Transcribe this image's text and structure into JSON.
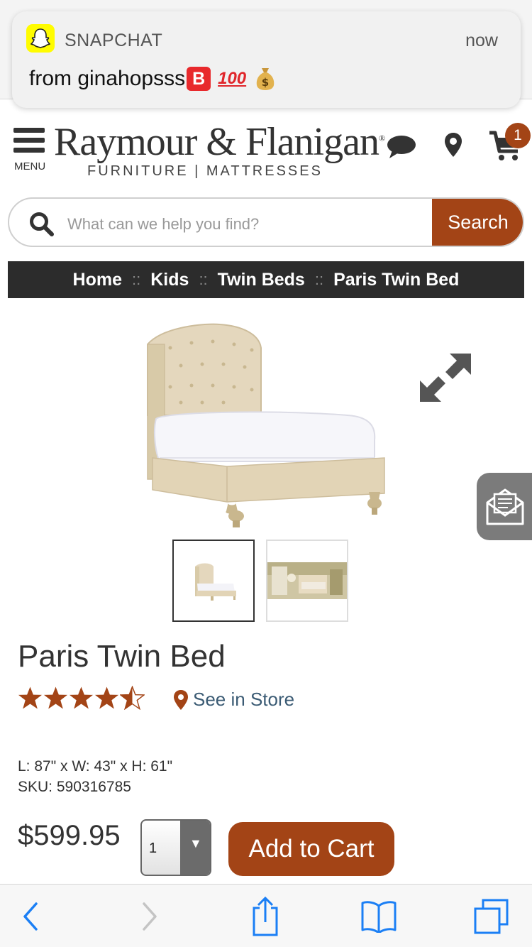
{
  "notification": {
    "app_name": "SNAPCHAT",
    "time": "now",
    "message": "from ginahopsss",
    "emoji_b": "B",
    "emoji_100": "100"
  },
  "header": {
    "menu_label": "MENU",
    "logo_main": "Raymour & Flanigan",
    "logo_mark": "®",
    "logo_sub": "FURNITURE | MATTRESSES",
    "cart_count": "1",
    "icons": [
      "menu-icon",
      "chat-bubble-icon",
      "location-pin-icon",
      "cart-icon"
    ]
  },
  "search": {
    "placeholder": "What can we help you find?",
    "button_label": "Search"
  },
  "breadcrumb": {
    "items": [
      "Home",
      "Kids",
      "Twin Beds",
      "Paris Twin Bed"
    ],
    "separator": "::"
  },
  "product": {
    "title": "Paris Twin Bed",
    "rating": 4.5,
    "rating_max": 5,
    "see_in_store": "See in Store",
    "dimensions": "L: 87\" x W: 43\" x H: 61\"",
    "sku": "SKU: 590316785",
    "price": "$599.95",
    "quantity": "1",
    "add_to_cart": "Add to Cart"
  },
  "colors": {
    "brand": "#a34416",
    "breadcrumb_bg": "#2c2c2c",
    "link": "#3b5b74"
  },
  "toolbar": {
    "icons": [
      "back-icon",
      "forward-icon",
      "share-icon",
      "bookmarks-icon",
      "tabs-icon"
    ]
  }
}
